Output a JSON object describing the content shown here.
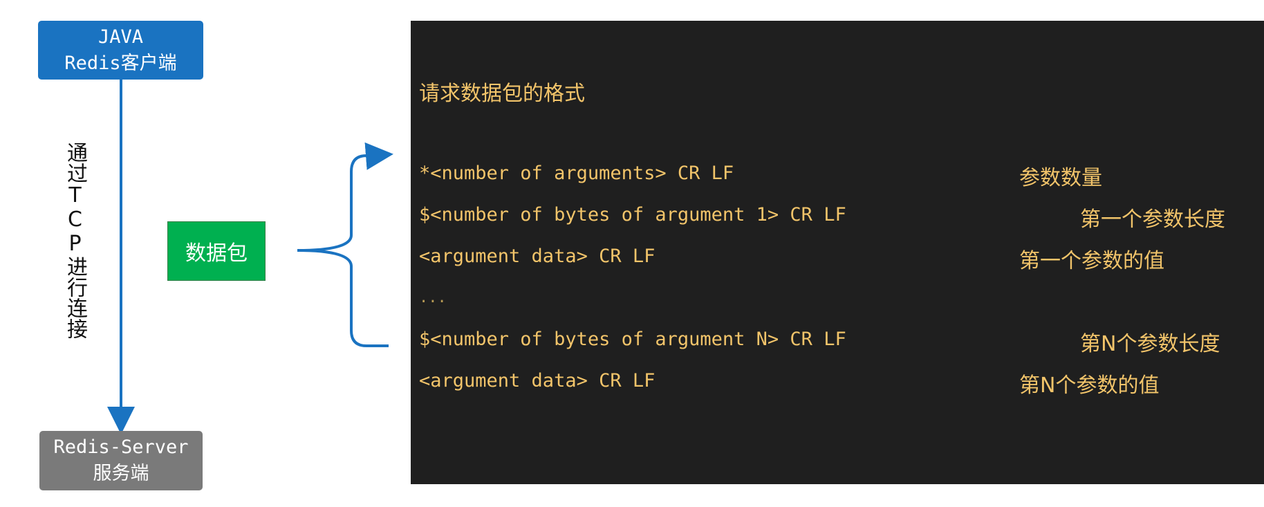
{
  "client": {
    "line1": "JAVA",
    "line2": "Redis客户端"
  },
  "server": {
    "line1": "Redis-Server",
    "line2": "服务端"
  },
  "connection_label": "通过TCP进行连接",
  "packet_label": "数据包",
  "terminal": {
    "title": "请求数据包的格式",
    "rows": [
      {
        "code": "*<number of arguments> CR LF",
        "note": "参数数量"
      },
      {
        "code": "$<number of bytes of argument 1> CR LF",
        "note": "第一个参数长度"
      },
      {
        "code": "<argument data> CR LF",
        "note": "第一个参数的值"
      },
      {
        "code": "...",
        "note": ""
      },
      {
        "code": "$<number of bytes of argument N> CR LF",
        "note": "第N个参数长度"
      },
      {
        "code": "<argument data> CR LF",
        "note": "第N个参数的值"
      }
    ]
  },
  "colors": {
    "client_box": "#1a73c1",
    "server_box": "#7a7a7a",
    "packet_box": "#00b050",
    "terminal_bg": "#1f1f1f",
    "terminal_text": "#f2c46a",
    "arrow": "#1a73c1"
  }
}
